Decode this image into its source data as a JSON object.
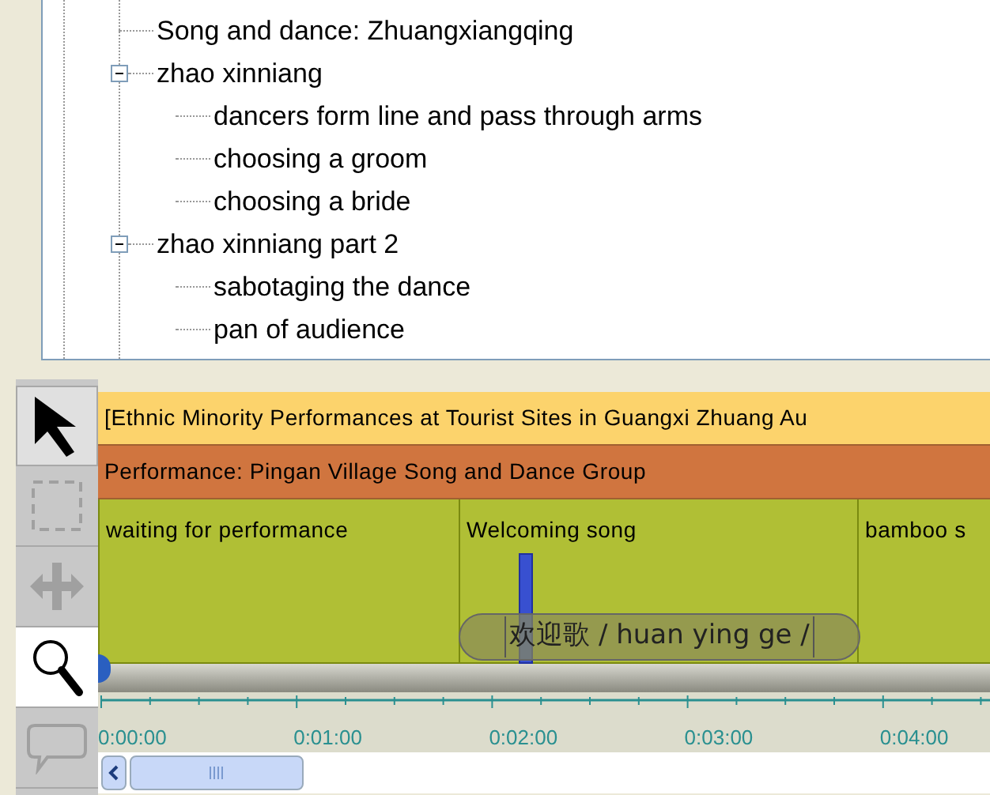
{
  "tree": {
    "items": [
      {
        "label": "Song and dance: Zhuangxiangqing"
      },
      {
        "label": "zhao xinniang",
        "expanded": true,
        "children": [
          {
            "label": "dancers form line and pass through arms"
          },
          {
            "label": "choosing a groom"
          },
          {
            "label": "choosing a bride"
          }
        ]
      },
      {
        "label": "zhao xinniang part 2",
        "expanded": true,
        "children": [
          {
            "label": "sabotaging the dance"
          },
          {
            "label": "pan of audience"
          }
        ]
      }
    ]
  },
  "tools": [
    {
      "kind": "pointer",
      "selected": false,
      "disabled": false
    },
    {
      "kind": "marquee",
      "selected": false,
      "disabled": true
    },
    {
      "kind": "move",
      "selected": false,
      "disabled": true
    },
    {
      "kind": "zoom",
      "selected": true,
      "disabled": false
    },
    {
      "kind": "comment",
      "selected": false,
      "disabled": true
    }
  ],
  "timeline": {
    "tiers": [
      {
        "label": "[Ethnic Minority Performances at Tourist Sites in Guangxi Zhuang Au",
        "color": "#fcd36c"
      },
      {
        "label": "Performance: Pingan Village Song and Dance Group",
        "color": "#d0753f"
      }
    ],
    "segments": [
      {
        "label": "waiting for performance"
      },
      {
        "label": "Welcoming song"
      },
      {
        "label": "bamboo s"
      }
    ],
    "annotation": {
      "text": "欢迎歌 / huan ying ge /"
    },
    "ruler": [
      "0:00:00",
      "0:01:00",
      "0:02:00",
      "0:03:00",
      "0:04:00"
    ]
  }
}
